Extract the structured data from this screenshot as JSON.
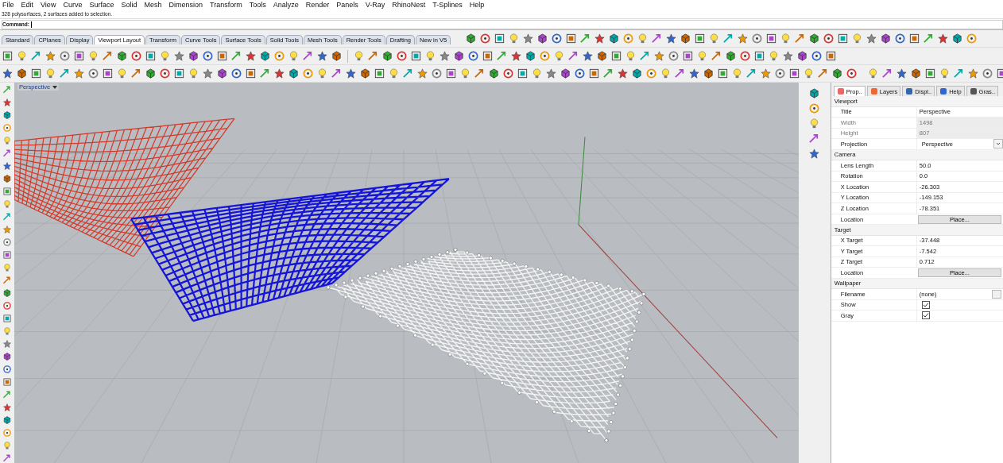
{
  "menu": [
    "File",
    "Edit",
    "View",
    "Curve",
    "Surface",
    "Solid",
    "Mesh",
    "Dimension",
    "Transform",
    "Tools",
    "Analyze",
    "Render",
    "Panels",
    "V-Ray",
    "RhinoNest",
    "T-Splines",
    "Help"
  ],
  "status_message": "328 polysurfaces, 2 surfaces added to selection.",
  "command": {
    "label": "Command:"
  },
  "toolbar_tabs": [
    {
      "label": "Standard",
      "selected": false
    },
    {
      "label": "CPlanes",
      "selected": false
    },
    {
      "label": "Display",
      "selected": false
    },
    {
      "label": "Viewport Layout",
      "selected": true
    },
    {
      "label": "Transform",
      "selected": false
    },
    {
      "label": "Curve Tools",
      "selected": false
    },
    {
      "label": "Surface Tools",
      "selected": false
    },
    {
      "label": "Solid Tools",
      "selected": false
    },
    {
      "label": "Mesh Tools",
      "selected": false
    },
    {
      "label": "Render Tools",
      "selected": false
    },
    {
      "label": "Drafting",
      "selected": false
    },
    {
      "label": "New in V5",
      "selected": false
    }
  ],
  "viewport": {
    "title": "Perspective"
  },
  "panel": {
    "tabs": [
      {
        "label": "Prop..",
        "selected": true
      },
      {
        "label": "Layers",
        "selected": false
      },
      {
        "label": "Displ..",
        "selected": false
      },
      {
        "label": "Help",
        "selected": false
      },
      {
        "label": "Gras..",
        "selected": false
      }
    ],
    "sections": [
      {
        "title": "Viewport",
        "rows": [
          {
            "label": "Title",
            "value": "Perspective",
            "kind": "text",
            "disabled": false
          },
          {
            "label": "Width",
            "value": "1498",
            "kind": "text",
            "disabled": true
          },
          {
            "label": "Height",
            "value": "807",
            "kind": "text",
            "disabled": true
          },
          {
            "label": "Projection",
            "value": "Perspective",
            "kind": "dropdown",
            "disabled": false
          }
        ]
      },
      {
        "title": "Camera",
        "rows": [
          {
            "label": "Lens Length",
            "value": "50.0",
            "kind": "text",
            "disabled": false
          },
          {
            "label": "Rotation",
            "value": "0.0",
            "kind": "text",
            "disabled": false
          },
          {
            "label": "X Location",
            "value": "-26.303",
            "kind": "text",
            "disabled": false
          },
          {
            "label": "Y Location",
            "value": "-149.153",
            "kind": "text",
            "disabled": false
          },
          {
            "label": "Z Location",
            "value": "-78.351",
            "kind": "text",
            "disabled": false
          },
          {
            "label": "Location",
            "value": "Place...",
            "kind": "button",
            "disabled": false
          }
        ]
      },
      {
        "title": "Target",
        "rows": [
          {
            "label": "X Target",
            "value": "-37.448",
            "kind": "text",
            "disabled": false
          },
          {
            "label": "Y Target",
            "value": "-7.542",
            "kind": "text",
            "disabled": false
          },
          {
            "label": "Z Target",
            "value": "0.712",
            "kind": "text",
            "disabled": false
          },
          {
            "label": "Location",
            "value": "Place...",
            "kind": "button",
            "disabled": false
          }
        ]
      },
      {
        "title": "Wallpaper",
        "rows": [
          {
            "label": "Filename",
            "value": "(none)",
            "kind": "file",
            "disabled": false
          },
          {
            "label": "Show",
            "checked": true,
            "kind": "checkbox",
            "disabled": false
          },
          {
            "label": "Gray",
            "checked": true,
            "kind": "checkbox",
            "disabled": false
          }
        ]
      }
    ]
  }
}
